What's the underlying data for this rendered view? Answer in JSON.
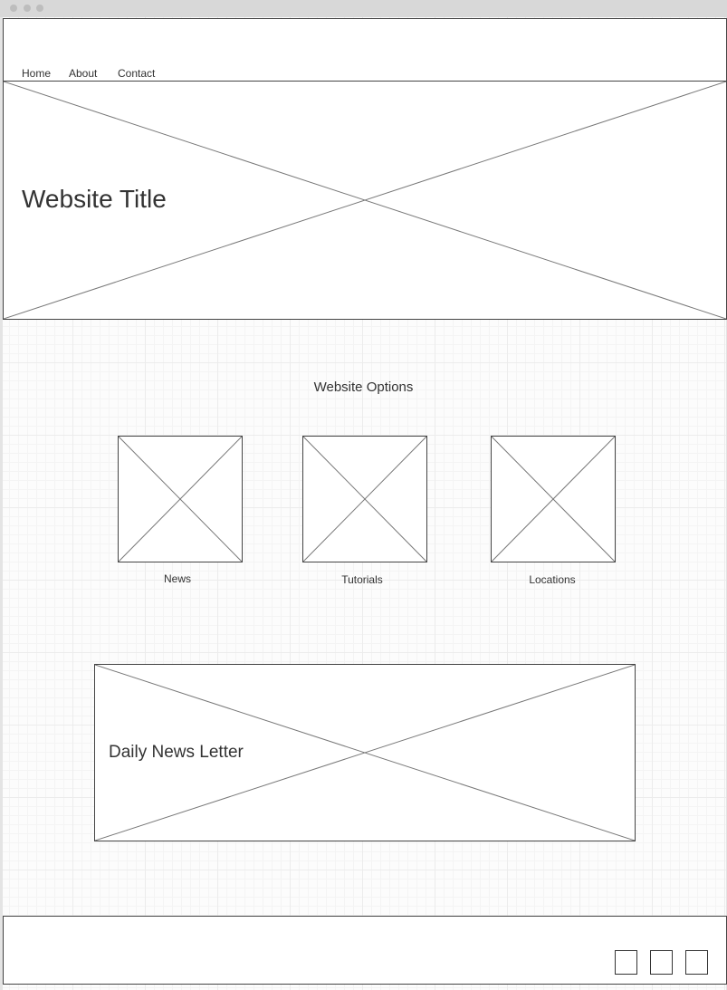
{
  "nav": {
    "items": [
      {
        "label": "Home"
      },
      {
        "label": "About"
      },
      {
        "label": "Contact"
      }
    ]
  },
  "hero": {
    "title": "Website Title"
  },
  "options": {
    "title": "Website Options",
    "cards": [
      {
        "label": "News"
      },
      {
        "label": "Tutorials"
      },
      {
        "label": "Locations"
      }
    ]
  },
  "newsletter": {
    "title": "Daily News Letter"
  },
  "footer": {
    "social_icons": [
      "social-icon-1",
      "social-icon-2",
      "social-icon-3"
    ]
  },
  "colors": {
    "border": "#444444",
    "text": "#333333",
    "placeholder_line": "#777777"
  }
}
